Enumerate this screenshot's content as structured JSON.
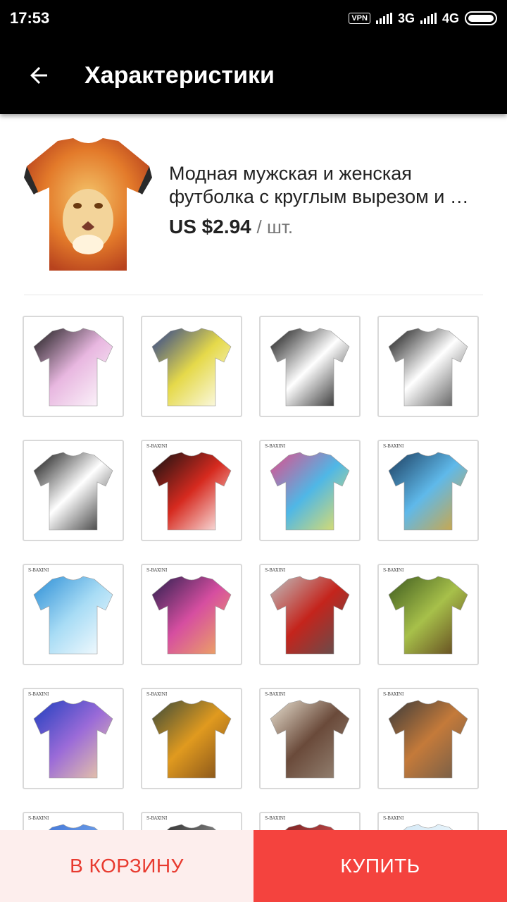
{
  "status_bar": {
    "time": "17:53",
    "vpn": "VPN",
    "network1": "3G",
    "network2": "4G"
  },
  "header": {
    "title": "Характеристики",
    "back_icon": "arrow-left-icon"
  },
  "product": {
    "title": "Модная мужская и женская футболка с круглым вырезом и …",
    "price": "US $2.94",
    "unit": "/ шт."
  },
  "variants": [
    {
      "name": "vortex-pink",
      "colors": [
        "#1a1a1a",
        "#e8b7e0",
        "#ffffff"
      ]
    },
    {
      "name": "radial-blue-yellow",
      "colors": [
        "#2a3f8f",
        "#e5d94a",
        "#ffffff"
      ]
    },
    {
      "name": "spiral-bw",
      "colors": [
        "#111111",
        "#ffffff",
        "#111111"
      ]
    },
    {
      "name": "checker-tunnel",
      "colors": [
        "#111111",
        "#ffffff",
        "#444444"
      ]
    },
    {
      "name": "stripes-bw",
      "colors": [
        "#111111",
        "#ffffff",
        "#222222"
      ]
    },
    {
      "name": "apple-red-black",
      "colors": [
        "#111111",
        "#d62a1f",
        "#ffffff"
      ],
      "brand": "S-BAXINI"
    },
    {
      "name": "colorful-splash",
      "colors": [
        "#e34b8a",
        "#4fb7e6",
        "#f2e35a"
      ],
      "brand": "S-BAXINI"
    },
    {
      "name": "blue-skull",
      "colors": [
        "#1b3c5e",
        "#5fb9ea",
        "#e0a42c"
      ],
      "brand": "S-BAXINI"
    },
    {
      "name": "water-splash",
      "colors": [
        "#2c8ed6",
        "#a8dcf5",
        "#ffffff"
      ],
      "brand": "S-BAXINI"
    },
    {
      "name": "galaxy-cat",
      "colors": [
        "#2a1f4e",
        "#d64ea0",
        "#f0b25a"
      ],
      "brand": "S-BAXINI"
    },
    {
      "name": "red-explosion",
      "colors": [
        "#bfbfbf",
        "#c4241c",
        "#555555"
      ],
      "brand": "S-BAXINI"
    },
    {
      "name": "forest",
      "colors": [
        "#3d5a1f",
        "#a7c04a",
        "#5b3a1a"
      ],
      "brand": "S-BAXINI"
    },
    {
      "name": "lightning-blue",
      "colors": [
        "#1f3fbf",
        "#9b6bd8",
        "#f3d3a0"
      ],
      "brand": "S-BAXINI"
    },
    {
      "name": "lion-dreadlocks",
      "colors": [
        "#3a4a3a",
        "#e09a1f",
        "#7a4a1a"
      ],
      "brand": "S-BAXINI"
    },
    {
      "name": "mushroom-cloud",
      "colors": [
        "#e8e0d0",
        "#6a4a3a",
        "#9a8a7a"
      ],
      "brand": "S-BAXINI"
    },
    {
      "name": "plumber",
      "colors": [
        "#3a3a3a",
        "#c47a3a",
        "#6a5a4a"
      ],
      "brand": "S-BAXINI"
    },
    {
      "name": "row5-a",
      "colors": [
        "#3b6fd6",
        "#6fa0e8",
        "#ffffff"
      ],
      "brand": "S-BAXINI"
    },
    {
      "name": "row5-b",
      "colors": [
        "#222222",
        "#888888",
        "#ffffff"
      ],
      "brand": "S-BAXINI"
    },
    {
      "name": "row5-c",
      "colors": [
        "#6a1a1a",
        "#c44a4a",
        "#ffffff"
      ],
      "brand": "S-BAXINI"
    },
    {
      "name": "row5-d",
      "colors": [
        "#cfe6f5",
        "#eaf5fb",
        "#ffffff"
      ],
      "brand": "S-BAXINI"
    }
  ],
  "actions": {
    "cart": "В КОРЗИНУ",
    "buy": "КУПИТЬ"
  },
  "colors": {
    "cart_bg": "#fdeeed",
    "cart_text": "#e83a2f",
    "buy_bg": "#f4433e",
    "appbar_bg": "#000000"
  }
}
